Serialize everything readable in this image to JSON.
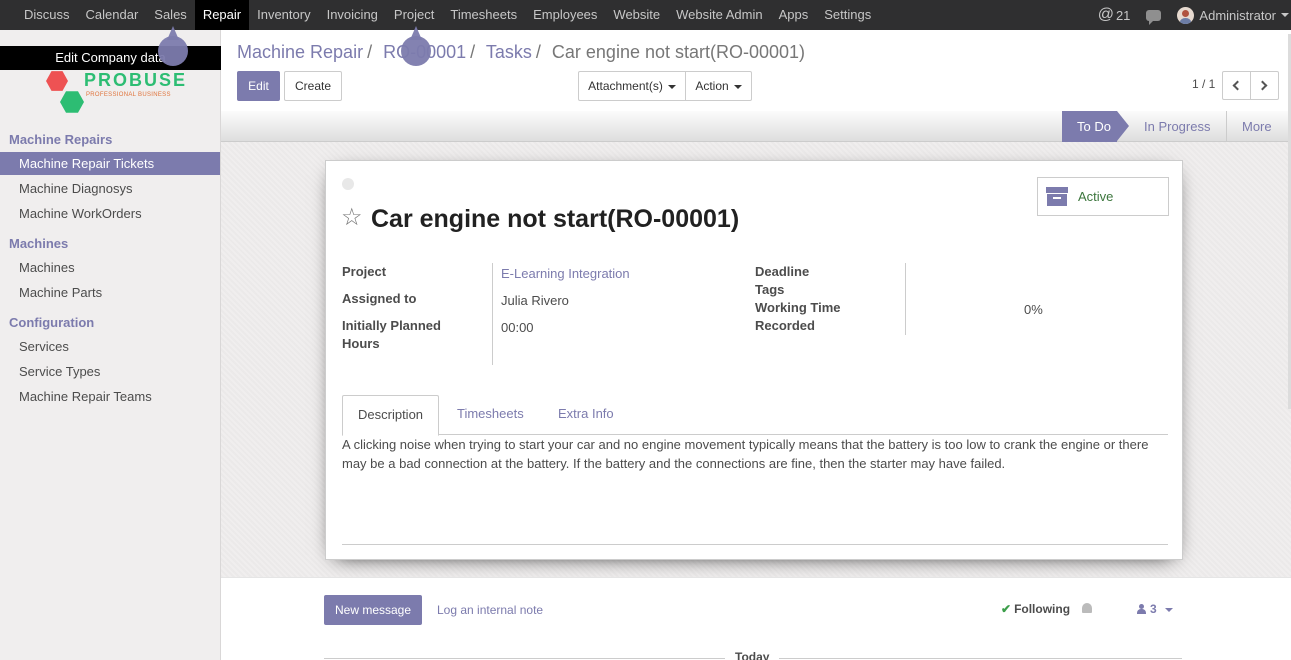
{
  "topbar": {
    "menu": [
      "Discuss",
      "Calendar",
      "Sales",
      "Repair",
      "Inventory",
      "Invoicing",
      "Project",
      "Timesheets",
      "Employees",
      "Website",
      "Website Admin",
      "Apps",
      "Settings"
    ],
    "active_menu": "Repair",
    "message_count": "21",
    "user": "Administrator"
  },
  "sidebar": {
    "tooltip": "Edit Company data",
    "logo": {
      "brand": "PROBUSE",
      "tagline": "PROFESSIONAL BUSINESS"
    },
    "sections": [
      {
        "title": "Machine Repairs",
        "items": [
          "Machine Repair Tickets",
          "Machine Diagnosys",
          "Machine WorkOrders"
        ]
      },
      {
        "title": "Machines",
        "items": [
          "Machines",
          "Machine Parts"
        ]
      },
      {
        "title": "Configuration",
        "items": [
          "Services",
          "Service Types",
          "Machine Repair Teams"
        ]
      }
    ],
    "active_item": "Machine Repair Tickets"
  },
  "breadcrumb": {
    "items": [
      "Machine Repair",
      "RO-00001",
      "Tasks"
    ],
    "current": "Car engine not start(RO-00001)"
  },
  "controls": {
    "edit": "Edit",
    "create": "Create",
    "attachments": "Attachment(s)",
    "action": "Action",
    "pager": "1 / 1"
  },
  "stages": [
    "To Do",
    "In Progress",
    "More"
  ],
  "current_stage": "To Do",
  "form": {
    "title": "Car engine not start(RO-00001)",
    "archive_status": "Active",
    "fields": {
      "project_label": "Project",
      "project_value": "E-Learning Integration",
      "assigned_label": "Assigned to",
      "assigned_value": "Julia Rivero",
      "planned_label_line1": "Initially Planned",
      "planned_label_line2": "Hours",
      "planned_value": "00:00",
      "deadline_label": "Deadline",
      "tags_label": "Tags",
      "working_label_line1": "Working Time",
      "working_label_line2": "Recorded",
      "working_value": "0%"
    },
    "tabs": [
      "Description",
      "Timesheets",
      "Extra Info"
    ],
    "active_tab": "Description",
    "description": "A clicking noise when trying to start your car and no engine movement typically means that the battery is too low to crank the engine or there may be a bad connection at the battery. If the battery and the connections are fine, then the starter may have failed."
  },
  "chatter": {
    "new_message": "New message",
    "log_note": "Log an internal note",
    "following": "Following",
    "followers_count": "3",
    "today": "Today"
  },
  "colors": {
    "primary": "#7c7bad",
    "topbar": "#2f2f30",
    "active_status": "#3c763d"
  }
}
